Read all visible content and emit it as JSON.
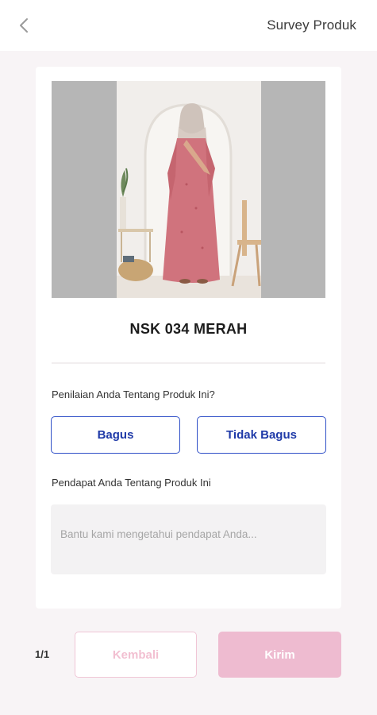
{
  "header": {
    "title": "Survey Produk",
    "back_icon": "chevron-left-icon"
  },
  "product": {
    "name": "NSK 034 MERAH",
    "image_alt": "NSK 034 MERAH"
  },
  "survey": {
    "rating_question": "Penilaian Anda Tentang Produk Ini?",
    "options": [
      "Bagus",
      "Tidak Bagus"
    ],
    "opinion_question": "Pendapat Anda Tentang Produk Ini",
    "opinion_placeholder": "Bantu kami mengetahui pendapat Anda...",
    "opinion_value": ""
  },
  "footer": {
    "page_indicator": "1/1",
    "back_label": "Kembali",
    "send_label": "Kirim"
  },
  "colors": {
    "accent_blue": "#2f4fc7",
    "pink_light": "#eebbd0",
    "dress_pink": "#d0737d",
    "background": "#f8f4f6"
  }
}
